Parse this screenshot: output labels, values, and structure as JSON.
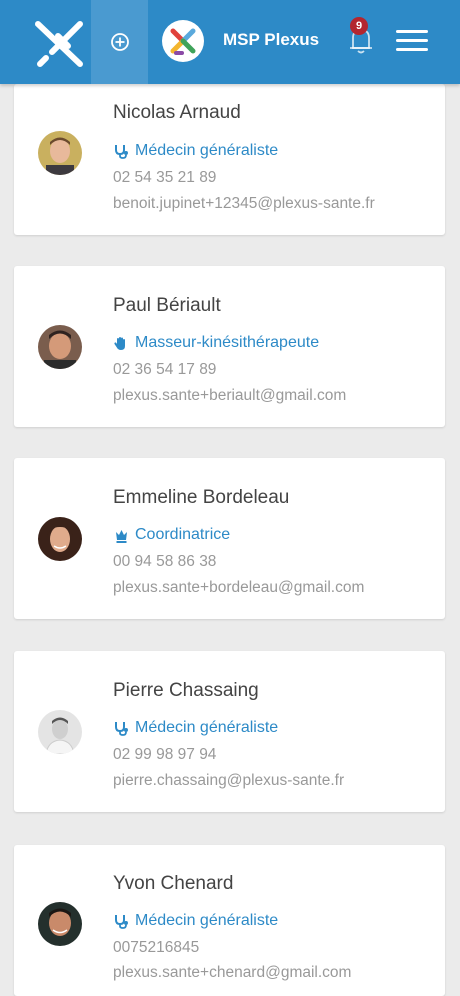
{
  "header": {
    "msp_name": "MSP Plexus",
    "notification_count": "9",
    "colors": {
      "bar": "#2d8ac7",
      "accent": "#4a9ad0",
      "badge": "#b3262f"
    }
  },
  "contacts": [
    {
      "name": "Nicolas Arnaud",
      "role": "Médecin généraliste",
      "role_icon": "stethoscope-icon",
      "phone": "02 54 35 21 89",
      "email": "benoit.jupinet+12345@plexus-sante.fr"
    },
    {
      "name": "Paul Bériault",
      "role": "Masseur-kinésithérapeute",
      "role_icon": "hand-icon",
      "phone": "02 36 54 17 89",
      "email": "plexus.sante+beriault@gmail.com"
    },
    {
      "name": "Emmeline  Bordeleau",
      "role": "Coordinatrice",
      "role_icon": "chess-queen-icon",
      "phone": "00 94 58 86 38",
      "email": "plexus.sante+bordeleau@gmail.com"
    },
    {
      "name": "Pierre Chassaing",
      "role": "Médecin généraliste",
      "role_icon": "stethoscope-icon",
      "phone": "02 99 98 97 94",
      "email": "pierre.chassaing@plexus-sante.fr"
    },
    {
      "name": "Yvon  Chenard",
      "role": "Médecin généraliste",
      "role_icon": "stethoscope-icon",
      "phone": "0075216845",
      "email": "plexus.sante+chenard@gmail.com"
    }
  ]
}
